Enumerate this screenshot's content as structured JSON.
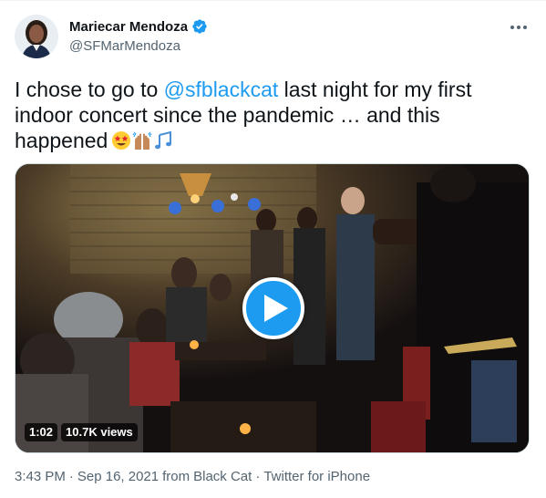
{
  "author": {
    "display_name": "Mariecar Mendoza",
    "handle": "@SFMarMendoza",
    "verified": true
  },
  "tweet": {
    "text_part1": "I chose to go to ",
    "mention": "@sfblackcat",
    "text_part2": " last night for my first indoor concert since the pandemic … and this happened",
    "emojis": [
      "star-struck-emoji",
      "raising-hands-emoji",
      "musical-notes-emoji"
    ]
  },
  "media": {
    "duration": "1:02",
    "views": "10.7K views"
  },
  "meta": {
    "time": "3:43 PM",
    "date": "Sep 16, 2021",
    "source_prefix": "from",
    "location": "Black Cat",
    "sep": "·",
    "client": "Twitter for iPhone"
  },
  "colors": {
    "link": "#1d9bf0",
    "secondary": "#536471",
    "text": "#0f1419"
  }
}
